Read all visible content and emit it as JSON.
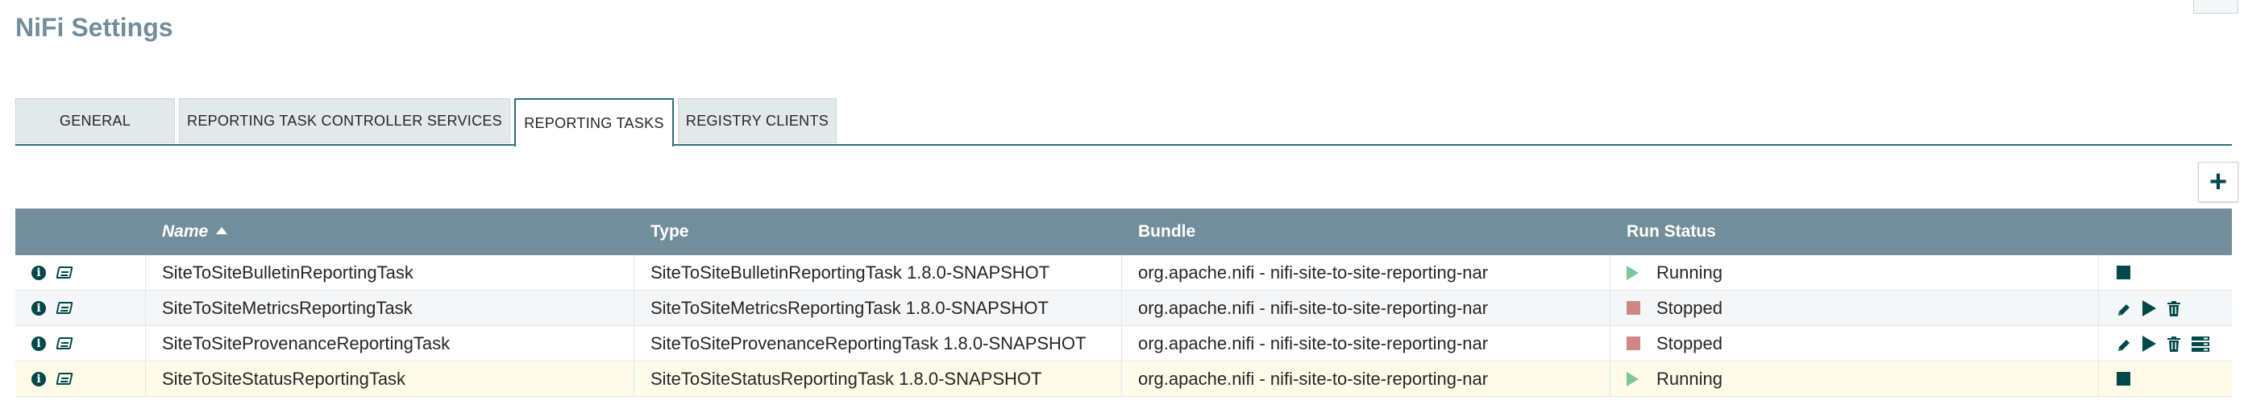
{
  "page": {
    "title": "NiFi Settings"
  },
  "tabs": [
    {
      "label": "GENERAL",
      "active": false
    },
    {
      "label": "REPORTING TASK CONTROLLER SERVICES",
      "active": false
    },
    {
      "label": "REPORTING TASKS",
      "active": true
    },
    {
      "label": "REGISTRY CLIENTS",
      "active": false
    }
  ],
  "toolbar": {
    "add_icon": "plus-icon",
    "add_label": "+"
  },
  "table": {
    "columns": {
      "name": "Name",
      "type": "Type",
      "bundle": "Bundle",
      "run_status": "Run Status"
    },
    "sort": {
      "column": "name",
      "direction": "ascending"
    },
    "rows": [
      {
        "name": "SiteToSiteBulletinReportingTask",
        "type": "SiteToSiteBulletinReportingTask 1.8.0-SNAPSHOT",
        "bundle": "org.apache.nifi - nifi-site-to-site-reporting-nar",
        "status": "Running",
        "status_icon": "running-icon",
        "actions": [
          "stop-icon"
        ]
      },
      {
        "name": "SiteToSiteMetricsReportingTask",
        "type": "SiteToSiteMetricsReportingTask 1.8.0-SNAPSHOT",
        "bundle": "org.apache.nifi - nifi-site-to-site-reporting-nar",
        "status": "Stopped",
        "status_icon": "stopped-icon",
        "actions": [
          "edit-icon",
          "start-icon",
          "delete-icon"
        ]
      },
      {
        "name": "SiteToSiteProvenanceReportingTask",
        "type": "SiteToSiteProvenanceReportingTask 1.8.0-SNAPSHOT",
        "bundle": "org.apache.nifi - nifi-site-to-site-reporting-nar",
        "status": "Stopped",
        "status_icon": "stopped-icon",
        "actions": [
          "edit-icon",
          "start-icon",
          "delete-icon",
          "view-state-icon"
        ]
      },
      {
        "name": "SiteToSiteStatusReportingTask",
        "type": "SiteToSiteStatusReportingTask 1.8.0-SNAPSHOT",
        "bundle": "org.apache.nifi - nifi-site-to-site-reporting-nar",
        "status": "Running",
        "status_icon": "running-icon",
        "actions": [
          "stop-icon"
        ],
        "selected": true
      }
    ]
  },
  "colors": {
    "header_bg": "#728e9b",
    "accent": "#004849",
    "running": "#7dc7a0",
    "stopped": "#d18686",
    "selected_row": "#fffbe9"
  }
}
